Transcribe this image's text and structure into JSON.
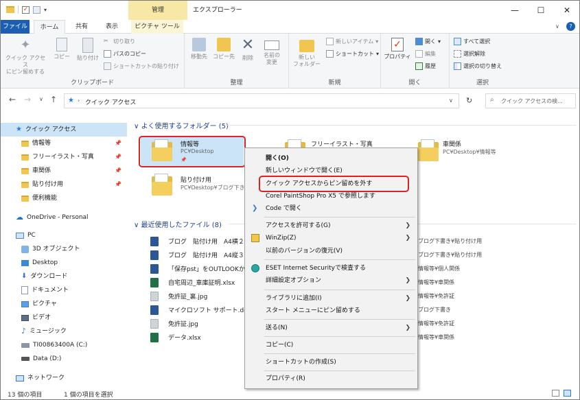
{
  "window": {
    "title": "エクスプローラー",
    "context_tab_group": "管理",
    "controls": {
      "minimize": "—",
      "maximize": "☐",
      "close": "✕"
    }
  },
  "tabs": {
    "file": "ファイル",
    "home": "ホーム",
    "share": "共有",
    "view": "表示",
    "picture_tools": "ピクチャ ツール"
  },
  "ribbon": {
    "clipboard": {
      "label": "クリップボード",
      "pin_quick": "クイック アクセス\nにピン留めする",
      "copy": "コピー",
      "paste": "貼り付け",
      "cut": "切り取り",
      "copy_path": "パスのコピー",
      "paste_shortcut": "ショートカットの貼り付け"
    },
    "organize": {
      "label": "整理",
      "move_to": "移動先",
      "copy_to": "コピー先",
      "delete": "削除",
      "rename": "名前の\n変更"
    },
    "new": {
      "label": "新規",
      "new_folder": "新しい\nフォルダー",
      "new_item": "新しいアイテム",
      "shortcut": "ショートカット"
    },
    "open": {
      "label": "開く",
      "properties": "プロパティ",
      "open": "開く",
      "edit": "編集",
      "history": "履歴"
    },
    "select": {
      "label": "選択",
      "select_all": "すべて選択",
      "select_none": "選択解除",
      "invert": "選択の切り替え"
    }
  },
  "address": {
    "path": "クイック アクセス",
    "search_placeholder": "クイック アクセスの検..."
  },
  "navpane": {
    "quick_access": "クイック アクセス",
    "pinned": [
      "情報等",
      "フリーイラスト・写真",
      "車関係",
      "貼り付け用",
      "便利機能"
    ],
    "onedrive": "OneDrive - Personal",
    "pc": "PC",
    "pc_items": [
      "3D オブジェクト",
      "Desktop",
      "ダウンロード",
      "ドキュメント",
      "ピクチャ",
      "ビデオ",
      "ミュージック",
      "TI00863400A (C:)",
      "Data (D:)"
    ],
    "network": "ネットワーク"
  },
  "frequent": {
    "header": "よく使用するフォルダー",
    "count": "(5)",
    "folders": [
      {
        "name": "情報等",
        "path": "PC¥Desktop"
      },
      {
        "name": "フリーイラスト・写真",
        "path": ""
      },
      {
        "name": "車関係",
        "path": "PC¥Desktop¥情報等"
      },
      {
        "name": "貼り付け用",
        "path": "PC¥Desktop¥ブログ下き"
      }
    ]
  },
  "recent": {
    "header": "最近使用したファイル",
    "count": "(8)",
    "files": [
      {
        "name": "ブログ　貼付け用　A4横２",
        "path": "ブログ下書き¥貼り付け用",
        "type": "w"
      },
      {
        "name": "ブログ　貼付け用　A4縦３",
        "path": "ブログ下書き¥貼り付け用",
        "type": "w"
      },
      {
        "name": "「保存pst」をOUTLOOKから",
        "path": "情報等¥個人関係",
        "type": "w"
      },
      {
        "name": "自宅周辺_車庫証明.xlsx",
        "path": "情報等¥車関係",
        "type": "x"
      },
      {
        "name": "免許証_裏.jpg",
        "path": "情報等¥免許証",
        "type": "j"
      },
      {
        "name": "マイクロソフト サポート.docx",
        "path": "ブログ下書き",
        "type": "w"
      },
      {
        "name": "免許証.jpg",
        "path": "情報等¥免許証",
        "type": "j"
      },
      {
        "name": "データ.xlsx",
        "path": "情報等¥車関係",
        "type": "x"
      }
    ]
  },
  "context_menu": {
    "open": "開く(O)",
    "open_new_window": "新しいウィンドウで開く(E)",
    "unpin": "クイック アクセスからピン留めを外す",
    "corel": "Corel PaintShop Pro X5 で参照します",
    "code": "Code で開く",
    "give_access": "アクセスを許可する(G)",
    "winzip": "WinZip(Z)",
    "restore": "以前のバージョンの復元(V)",
    "eset": "ESET Internet Securityで検査する",
    "advanced": "詳細設定オプション",
    "library": "ライブラリに追加(I)",
    "pin_start": "スタート メニューにピン留めする",
    "send_to": "送る(N)",
    "copy": "コピー(C)",
    "create_shortcut": "ショートカットの作成(S)",
    "properties": "プロパティ(R)"
  },
  "status": {
    "items": "13 個の項目",
    "selected": "1 個の項目を選択"
  },
  "colors": {
    "accent": "#1a5fb4",
    "highlight": "#e02020",
    "selection": "#cce4f7"
  }
}
